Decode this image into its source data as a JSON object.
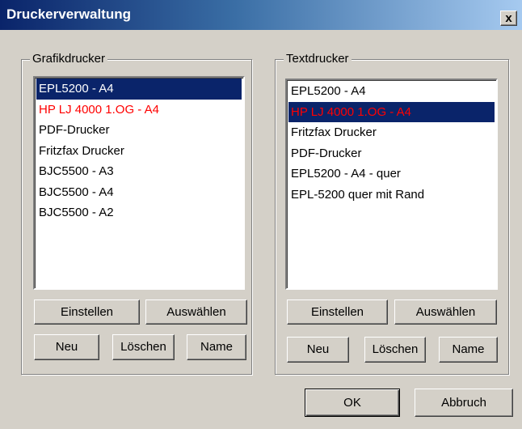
{
  "window": {
    "title": "Druckerverwaltung",
    "close_label": "x"
  },
  "graphic": {
    "label": "Grafikdrucker",
    "items": [
      "EPL5200 - A4",
      "HP LJ 4000 1.OG - A4",
      "PDF-Drucker",
      "Fritzfax Drucker",
      "BJC5500 - A3",
      "BJC5500 - A4",
      "BJC5500 - A2"
    ],
    "selected_index": 0,
    "red_index": 1,
    "buttons": {
      "setup": "Einstellen",
      "select": "Auswählen",
      "new": "Neu",
      "delete": "Löschen",
      "name": "Name"
    }
  },
  "text": {
    "label": "Textdrucker",
    "items": [
      "EPL5200 - A4",
      "HP LJ 4000 1.OG - A4",
      "Fritzfax Drucker",
      "PDF-Drucker",
      "EPL5200 - A4 - quer",
      "EPL-5200 quer mit Rand"
    ],
    "selected_index": 1,
    "red_index": 1,
    "buttons": {
      "setup": "Einstellen",
      "select": "Auswählen",
      "new": "Neu",
      "delete": "Löschen",
      "name": "Name"
    }
  },
  "dialog": {
    "ok_label": "OK",
    "cancel_label": "Abbruch"
  },
  "colors": {
    "selection": "#0a246a",
    "warning_text": "#ff0000",
    "face": "#d4d0c8"
  }
}
